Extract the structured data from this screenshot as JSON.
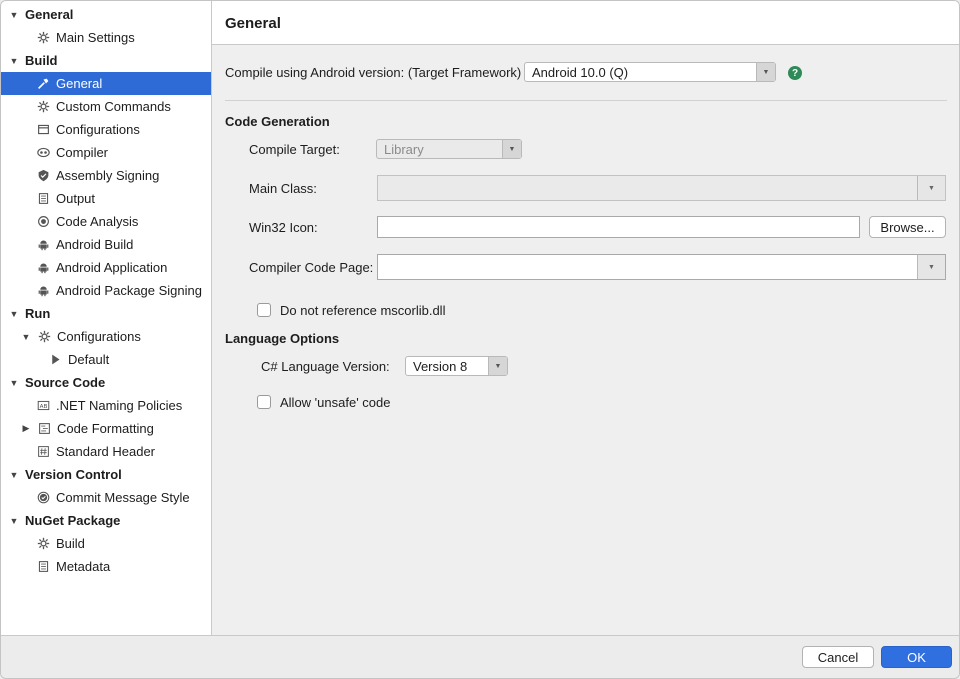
{
  "sidebar": {
    "items": [
      {
        "label": "General",
        "type": "category",
        "disclosure": "▼"
      },
      {
        "label": "Main Settings",
        "icon": "gear-icon"
      },
      {
        "label": "Build",
        "type": "category",
        "disclosure": "▼"
      },
      {
        "label": "General",
        "icon": "hammer-icon",
        "selected": true
      },
      {
        "label": "Custom Commands",
        "icon": "gear-icon"
      },
      {
        "label": "Configurations",
        "icon": "window-icon"
      },
      {
        "label": "Compiler",
        "icon": "compiler-icon"
      },
      {
        "label": "Assembly Signing",
        "icon": "shield-check-icon"
      },
      {
        "label": "Output",
        "icon": "document-icon"
      },
      {
        "label": "Code Analysis",
        "icon": "radio-circle-icon"
      },
      {
        "label": "Android Build",
        "icon": "android-icon"
      },
      {
        "label": "Android Application",
        "icon": "android-icon"
      },
      {
        "label": "Android Package Signing",
        "icon": "android-icon"
      },
      {
        "label": "Run",
        "type": "category",
        "disclosure": "▼"
      },
      {
        "label": "Configurations",
        "icon": "gear-icon",
        "disclosure": "▼"
      },
      {
        "label": "Default",
        "icon": "play-icon"
      },
      {
        "label": "Source Code",
        "type": "category",
        "disclosure": "▼"
      },
      {
        "label": ".NET Naming Policies",
        "icon": "naming-icon"
      },
      {
        "label": "Code Formatting",
        "icon": "code-format-icon",
        "disclosure": "▶"
      },
      {
        "label": "Standard Header",
        "icon": "hash-icon"
      },
      {
        "label": "Version Control",
        "type": "category",
        "disclosure": "▼"
      },
      {
        "label": "Commit Message Style",
        "icon": "check-circle-icon"
      },
      {
        "label": "NuGet Package",
        "type": "category",
        "disclosure": "▼"
      },
      {
        "label": "Build",
        "icon": "gear-icon"
      },
      {
        "label": "Metadata",
        "icon": "document-icon"
      }
    ]
  },
  "header": {
    "title": "General"
  },
  "target": {
    "label": "Compile using Android version: (Target Framework)",
    "value": "Android 10.0 (Q)",
    "help": "?"
  },
  "codegen": {
    "heading": "Code Generation",
    "compile_target_label": "Compile Target:",
    "compile_target_value": "Library",
    "main_class_label": "Main Class:",
    "main_class_value": "",
    "win32_icon_label": "Win32 Icon:",
    "win32_icon_value": "",
    "browse_label": "Browse...",
    "code_page_label": "Compiler Code Page:",
    "code_page_value": "",
    "no_mscorlib_label": "Do not reference mscorlib.dll",
    "no_mscorlib_checked": false
  },
  "language": {
    "heading": "Language Options",
    "version_label": "C# Language Version:",
    "version_value": "Version 8",
    "unsafe_label": "Allow 'unsafe' code",
    "unsafe_checked": false
  },
  "footer": {
    "cancel_label": "Cancel",
    "ok_label": "OK"
  },
  "colors": {
    "accent": "#2e6bd6",
    "help": "#2e8b57",
    "ok_button": "#2f6fe0"
  }
}
